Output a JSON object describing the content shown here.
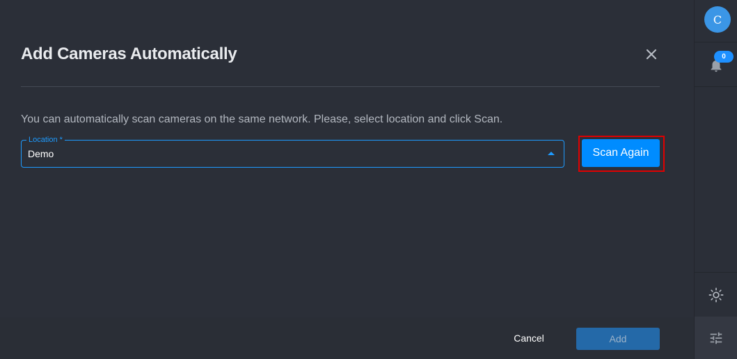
{
  "dialog": {
    "title": "Add Cameras Automatically",
    "description": "You can automatically scan cameras on the same network. Please, select location and click Scan.",
    "close_icon": "close-icon",
    "location": {
      "label": "Location *",
      "value": "Demo",
      "arrow_icon": "caret-up-icon"
    },
    "scan_again_label": "Scan Again",
    "cancel_label": "Cancel",
    "add_label": "Add"
  },
  "sidebar": {
    "avatar_initial": "C",
    "notifications_count": "0",
    "bell_icon": "bell-icon",
    "theme_icon": "sun-icon",
    "settings_icon": "tune-icon"
  },
  "colors": {
    "background": "#2b2f38",
    "accent": "#008cff",
    "highlight_outline": "#e00000",
    "add_disabled": "#2469a8"
  }
}
